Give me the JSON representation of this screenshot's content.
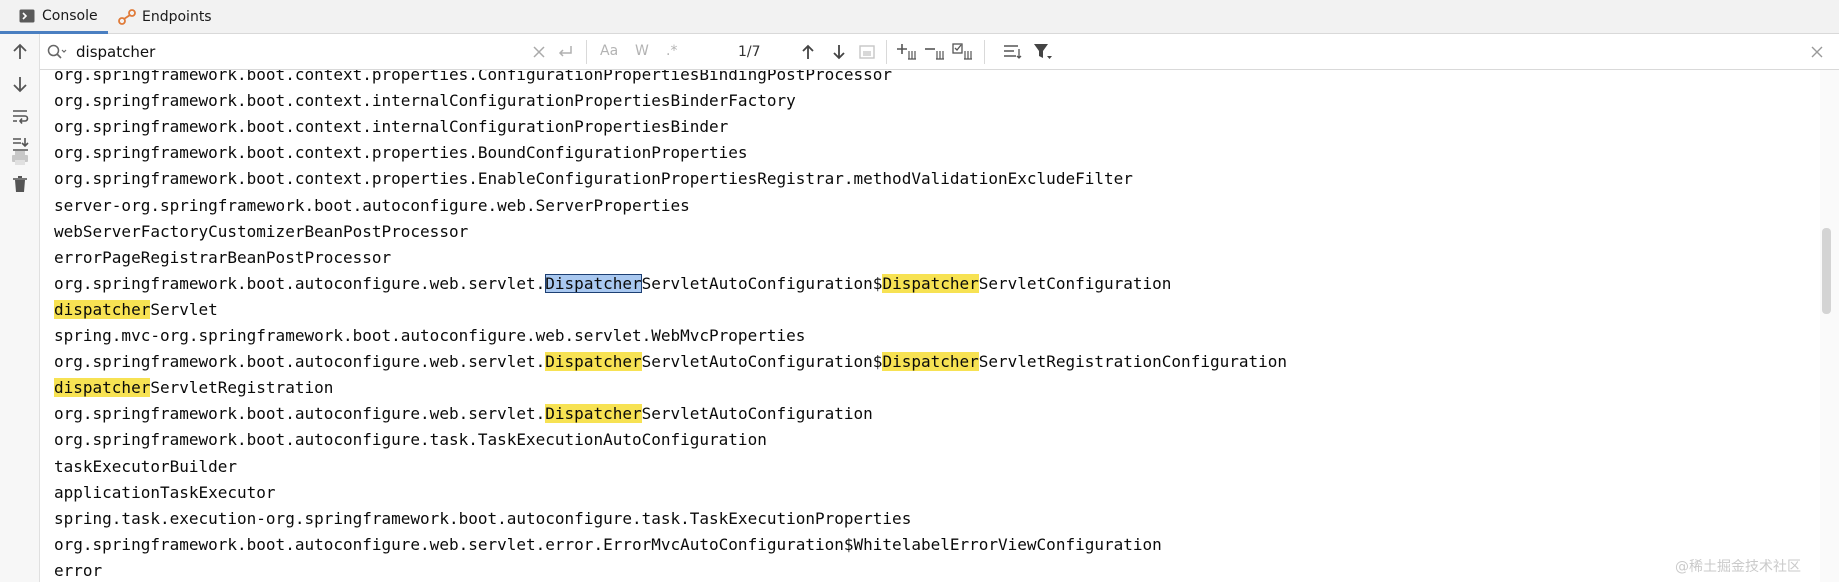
{
  "tabs": [
    {
      "label": "Console",
      "icon": "console-icon"
    },
    {
      "label": "Endpoints",
      "icon": "endpoints-icon"
    }
  ],
  "search": {
    "value": "dispatcher",
    "case_label": "Aa",
    "word_label": "W",
    "regex_label": ".*",
    "match_count": "1/7"
  },
  "console_lines": [
    {
      "segments": [
        {
          "t": "org.springframework.boot.context.properties.ConfigurationPropertiesBindingPostProcessor"
        }
      ]
    },
    {
      "segments": [
        {
          "t": "org.springframework.boot.context.internalConfigurationPropertiesBinderFactory"
        }
      ]
    },
    {
      "segments": [
        {
          "t": "org.springframework.boot.context.internalConfigurationPropertiesBinder"
        }
      ]
    },
    {
      "segments": [
        {
          "t": "org.springframework.boot.context.properties.BoundConfigurationProperties"
        }
      ]
    },
    {
      "segments": [
        {
          "t": "org.springframework.boot.context.properties.EnableConfigurationPropertiesRegistrar.methodValidationExcludeFilter"
        }
      ]
    },
    {
      "segments": [
        {
          "t": "server-org.springframework.boot.autoconfigure.web.ServerProperties"
        }
      ]
    },
    {
      "segments": [
        {
          "t": "webServerFactoryCustomizerBeanPostProcessor"
        }
      ]
    },
    {
      "segments": [
        {
          "t": "errorPageRegistrarBeanPostProcessor"
        }
      ]
    },
    {
      "segments": [
        {
          "t": "org.springframework.boot.autoconfigure.web.servlet."
        },
        {
          "t": "Dispatcher",
          "h": "current"
        },
        {
          "t": "ServletAutoConfiguration$"
        },
        {
          "t": "Dispatcher",
          "h": "match"
        },
        {
          "t": "ServletConfiguration"
        }
      ]
    },
    {
      "segments": [
        {
          "t": "dispatcher",
          "h": "match"
        },
        {
          "t": "Servlet"
        }
      ]
    },
    {
      "segments": [
        {
          "t": "spring.mvc-org.springframework.boot.autoconfigure.web.servlet.WebMvcProperties"
        }
      ]
    },
    {
      "segments": [
        {
          "t": "org.springframework.boot.autoconfigure.web.servlet."
        },
        {
          "t": "Dispatcher",
          "h": "match"
        },
        {
          "t": "ServletAutoConfiguration$"
        },
        {
          "t": "Dispatcher",
          "h": "match"
        },
        {
          "t": "ServletRegistrationConfiguration"
        }
      ]
    },
    {
      "segments": [
        {
          "t": "dispatcher",
          "h": "match"
        },
        {
          "t": "ServletRegistration"
        }
      ]
    },
    {
      "segments": [
        {
          "t": "org.springframework.boot.autoconfigure.web.servlet."
        },
        {
          "t": "Dispatcher",
          "h": "match"
        },
        {
          "t": "ServletAutoConfiguration"
        }
      ]
    },
    {
      "segments": [
        {
          "t": "org.springframework.boot.autoconfigure.task.TaskExecutionAutoConfiguration"
        }
      ]
    },
    {
      "segments": [
        {
          "t": "taskExecutorBuilder"
        }
      ]
    },
    {
      "segments": [
        {
          "t": "applicationTaskExecutor"
        }
      ]
    },
    {
      "segments": [
        {
          "t": "spring.task.execution-org.springframework.boot.autoconfigure.task.TaskExecutionProperties"
        }
      ]
    },
    {
      "segments": [
        {
          "t": "org.springframework.boot.autoconfigure.web.servlet.error.ErrorMvcAutoConfiguration$WhitelabelErrorViewConfiguration"
        }
      ]
    },
    {
      "segments": [
        {
          "t": "error"
        }
      ]
    }
  ],
  "watermark": "@稀土掘金技术社区",
  "colors": {
    "match_highlight": "#f7e253",
    "current_match": "#a9c8f0",
    "tab_underline": "#4a7fc1"
  }
}
